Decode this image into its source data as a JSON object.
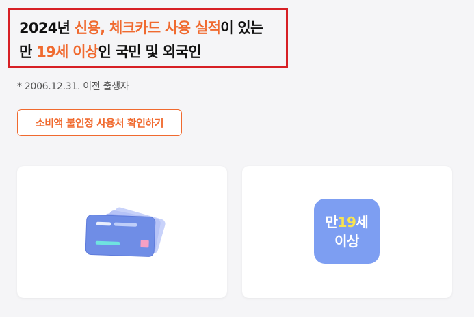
{
  "headline": {
    "line1_a": "2024년 ",
    "line1_highlight": "신용, 체크카드 사용 실적",
    "line1_b": "이 있는",
    "line2_a": "만 ",
    "line2_highlight": "19세 이상",
    "line2_b": "인 국민 및 외국인"
  },
  "note": "* 2006.12.31. 이전 출생자",
  "store_button_label": "소비액 불인정 사용처 확인하기",
  "age_badge": {
    "prefix": "만",
    "number": "19",
    "suffix": "세",
    "line2": "이상"
  },
  "colors": {
    "accent": "#f06a2f",
    "highlight_border": "#d72025",
    "badge_bg": "#7d9ef2",
    "badge_number": "#f8e34f",
    "card_front": "#6f8de6",
    "card_back": "#a9b7f3"
  },
  "icons": {
    "cards": "credit-cards-icon"
  }
}
